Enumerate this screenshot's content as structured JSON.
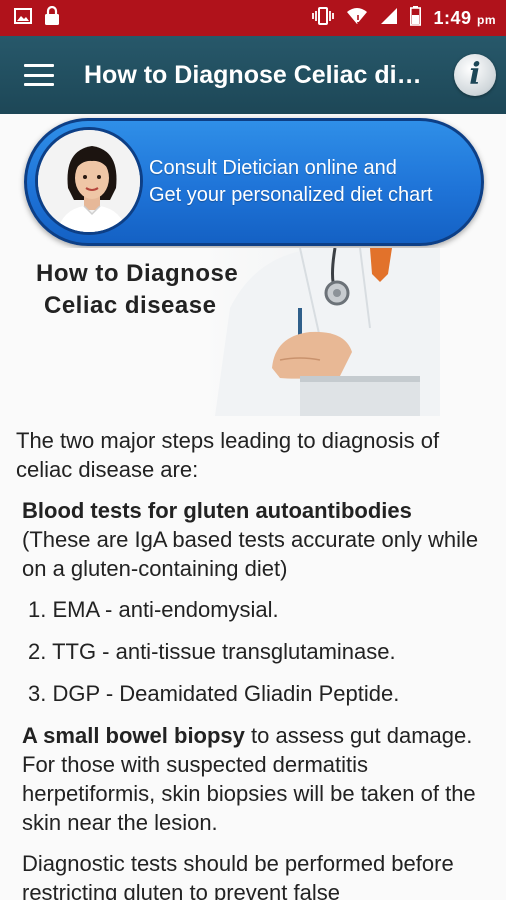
{
  "status_bar": {
    "time": "1:49",
    "ampm": "pm",
    "left_icons": [
      "image-icon",
      "lock-icon"
    ],
    "right_icons": [
      "vibrate-icon",
      "wifi-icon",
      "signal-icon",
      "battery-icon"
    ]
  },
  "app_bar": {
    "title": "How to Diagnose Celiac disease",
    "menu_icon": "menu-icon",
    "info_icon": "info-icon",
    "info_glyph": "i"
  },
  "banner": {
    "line1": "Consult Dietician online and",
    "line2": "Get your personalized diet chart"
  },
  "hero": {
    "line1": "How to Diagnose",
    "line2": "Celiac disease"
  },
  "article": {
    "intro": "The two major steps leading to diagnosis of celiac disease are:",
    "blood_heading": "Blood tests for gluten autoantibodies",
    "blood_note": "(These are IgA based tests accurate only while on a gluten-containing diet)",
    "tests": [
      "1. EMA - anti-endomysial.",
      "2. TTG - anti-tissue transglutaminase.",
      "3. DGP - Deamidated Gliadin Peptide."
    ],
    "biopsy_heading": "A small bowel biopsy",
    "biopsy_text": " to assess gut damage. For those with suspected dermatitis herpetiformis, skin biopsies will be taken of the skin near the lesion.",
    "closing": "Diagnostic tests should be performed before restricting gluten to prevent false"
  },
  "colors": {
    "status_bar": "#b0121b",
    "app_bar": "#1d4757",
    "banner": "#1f74d8"
  }
}
